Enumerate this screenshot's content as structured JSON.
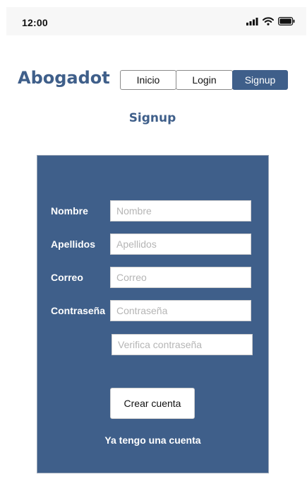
{
  "status_bar": {
    "time": "12:00",
    "icons": [
      "signal-icon",
      "wifi-icon",
      "battery-icon"
    ]
  },
  "header": {
    "brand": "Abogadot",
    "nav": [
      {
        "label": "Inicio",
        "active": false
      },
      {
        "label": "Login",
        "active": false
      },
      {
        "label": "Signup",
        "active": true
      }
    ]
  },
  "page": {
    "title": "Signup"
  },
  "form": {
    "fields": [
      {
        "label": "Nombre",
        "placeholder": "Nombre",
        "value": ""
      },
      {
        "label": "Apellidos",
        "placeholder": "Apellidos",
        "value": ""
      },
      {
        "label": "Correo",
        "placeholder": "Correo",
        "value": ""
      },
      {
        "label": "Contraseña",
        "placeholder": "Contraseña",
        "value": ""
      },
      {
        "label": "",
        "placeholder": "Verifica contraseña",
        "value": ""
      }
    ],
    "submit_label": "Crear cuenta",
    "link_label": "Ya tengo una cuenta"
  },
  "colors": {
    "primary": "#3f5f8a",
    "background": "#ffffff",
    "status_bar_bg": "#f7f7f7"
  }
}
